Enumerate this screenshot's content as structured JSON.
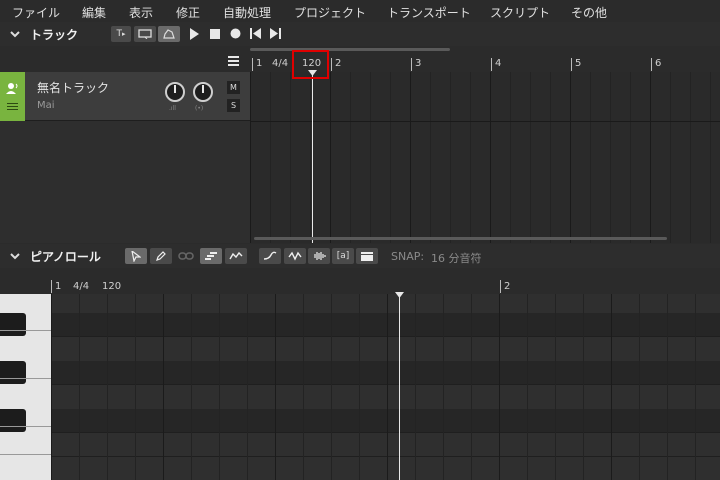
{
  "menu": {
    "items": [
      "ファイル",
      "編集",
      "表示",
      "修正",
      "自動処理",
      "プロジェクト",
      "トランスポート",
      "スクリプト",
      "その他"
    ]
  },
  "track_section": {
    "title": "トラック",
    "ruler": {
      "bar1": "1",
      "time_sig": "4/4",
      "tempo": "120",
      "bar2": "2",
      "bar3": "3",
      "bar4": "4",
      "bar5": "5",
      "bar6": "6"
    },
    "track": {
      "name": "無名トラック",
      "instrument": "Mai",
      "mute_label": "M",
      "solo_label": "S"
    },
    "playhead_position": "120",
    "transport_label": "T"
  },
  "piano_roll": {
    "title": "ピアノロール",
    "snap_label": "SNAP:",
    "snap_value": "16 分音符",
    "ruler": {
      "bar1": "1",
      "time_sig": "4/4",
      "tempo": "120",
      "bar2": "2"
    },
    "lyric_tool_label": "[a]"
  },
  "colors": {
    "track_color": "#79b43f",
    "highlight": "#e00000"
  }
}
